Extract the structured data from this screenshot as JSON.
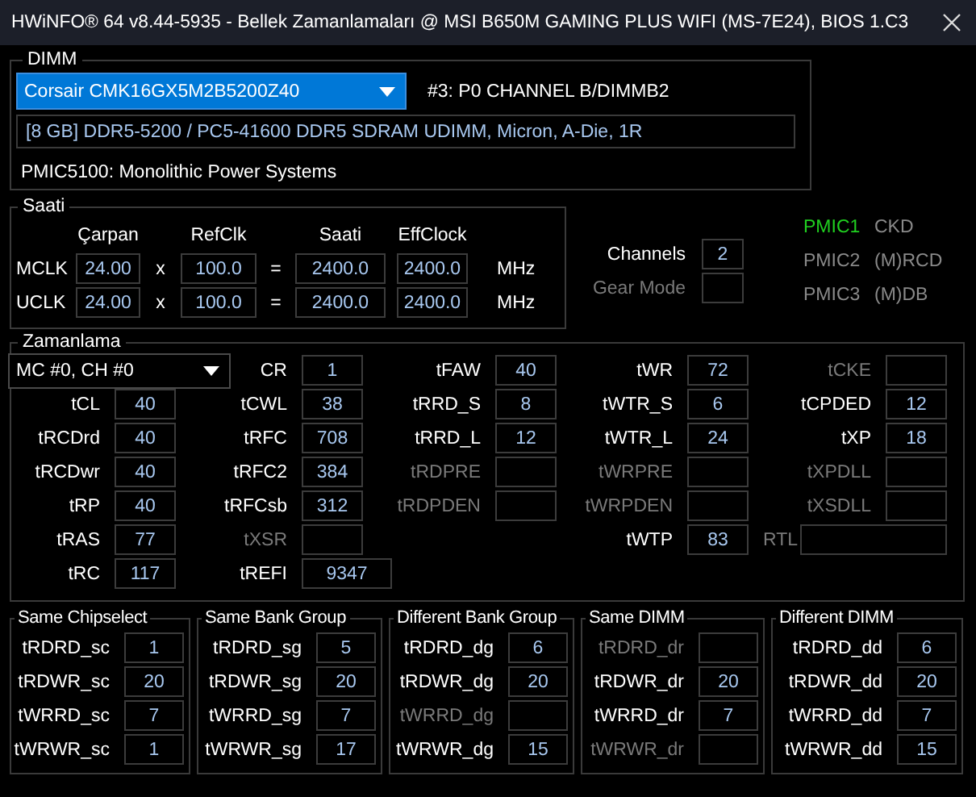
{
  "window": {
    "title": "HWiNFO® 64 v8.44-5935 - Bellek Zamanlamaları @ MSI B650M GAMING PLUS WIFI (MS-7E24), BIOS 1.C3"
  },
  "dimm": {
    "legend": "DIMM",
    "module": "Corsair CMK16GX5M2B5200Z40",
    "slot": "#3: P0 CHANNEL B/DIMMB2",
    "info": "[8 GB] DDR5-5200 / PC5-41600 DDR5 SDRAM UDIMM, Micron, A-Die, 1R",
    "pmic": "PMIC5100: Monolithic Power Systems"
  },
  "clock": {
    "legend": "Saati",
    "headers": [
      "Çarpan",
      "RefClk",
      "Saati",
      "EffClock"
    ],
    "rows": [
      {
        "label": "MCLK",
        "multiplier": "24.00",
        "times": "x",
        "refclk": "100.0",
        "equals": "=",
        "clock": "2400.0",
        "effclock": "2400.0",
        "unit": "MHz"
      },
      {
        "label": "UCLK",
        "multiplier": "24.00",
        "times": "x",
        "refclk": "100.0",
        "equals": "=",
        "clock": "2400.0",
        "effclock": "2400.0",
        "unit": "MHz"
      }
    ]
  },
  "memory_info": [
    {
      "label": "Channels",
      "value": "2",
      "disabled": false
    },
    {
      "label": "Gear Mode",
      "disabled": true
    }
  ],
  "pmics": [
    {
      "label": "PMIC1",
      "name": "CKD",
      "active": true
    },
    {
      "label": "PMIC2",
      "name": "(M)RCD",
      "active": false
    },
    {
      "label": "PMIC3",
      "name": "(M)DB",
      "active": false
    }
  ],
  "timings": {
    "legend": "Zamanlama",
    "controller": "MC #0, CH #0",
    "columns": [
      [
        {
          "kind": "field",
          "label": "tCL",
          "value": "40",
          "disabled": false
        },
        {
          "kind": "field",
          "label": "tRCDrd",
          "value": "40",
          "disabled": false
        },
        {
          "kind": "field",
          "label": "tRCDwr",
          "value": "40",
          "disabled": false
        },
        {
          "kind": "field",
          "label": "tRP",
          "value": "40",
          "disabled": false
        },
        {
          "kind": "field",
          "label": "tRAS",
          "value": "77",
          "disabled": false
        },
        {
          "kind": "field",
          "label": "tRC",
          "value": "117",
          "disabled": false
        }
      ],
      [
        {
          "kind": "field",
          "label": "CR",
          "value": "1",
          "disabled": false
        },
        {
          "kind": "field",
          "label": "tCWL",
          "value": "38",
          "disabled": false
        },
        {
          "kind": "field",
          "label": "tRFC",
          "value": "708",
          "disabled": false
        },
        {
          "kind": "field",
          "label": "tRFC2",
          "value": "384",
          "disabled": false
        },
        {
          "kind": "field",
          "label": "tRFCsb",
          "value": "312",
          "disabled": false
        },
        {
          "kind": "field",
          "label": "tXSR",
          "disabled": true
        },
        {
          "kind": "wide",
          "label": "tREFI",
          "value": "9347",
          "disabled": false
        }
      ],
      [
        {
          "kind": "field",
          "label": "tFAW",
          "value": "40",
          "disabled": false
        },
        {
          "kind": "field",
          "label": "tRRD_S",
          "value": "8",
          "disabled": false
        },
        {
          "kind": "field",
          "label": "tRRD_L",
          "value": "12",
          "disabled": false
        },
        {
          "kind": "field",
          "label": "tRDPRE",
          "disabled": true
        },
        {
          "kind": "field",
          "label": "tRDPDEN",
          "disabled": true
        }
      ],
      [
        {
          "kind": "field",
          "label": "tWR",
          "value": "72",
          "disabled": false
        },
        {
          "kind": "field",
          "label": "tWTR_S",
          "value": "6",
          "disabled": false
        },
        {
          "kind": "field",
          "label": "tWTR_L",
          "value": "24",
          "disabled": false
        },
        {
          "kind": "field",
          "label": "tWRPRE",
          "disabled": true
        },
        {
          "kind": "field",
          "label": "tWRPDEN",
          "disabled": true
        },
        {
          "kind": "field",
          "label": "tWTP",
          "value": "83",
          "disabled": false
        }
      ],
      [
        {
          "kind": "field",
          "label": "tCKE",
          "disabled": true
        },
        {
          "kind": "field",
          "label": "tCPDED",
          "value": "12",
          "disabled": false
        },
        {
          "kind": "field",
          "label": "tXP",
          "value": "18",
          "disabled": false
        },
        {
          "kind": "field",
          "label": "tXPDLL",
          "disabled": true
        },
        {
          "kind": "field",
          "label": "tXSDLL",
          "disabled": true
        },
        {
          "kind": "inline",
          "label": "RTL",
          "disabled": true
        }
      ]
    ]
  },
  "groups": [
    {
      "legend": "Same Chipselect",
      "items": [
        {
          "label": "tRDRD_sc",
          "value": "1",
          "disabled": false
        },
        {
          "label": "tRDWR_sc",
          "value": "20",
          "disabled": false
        },
        {
          "label": "tWRRD_sc",
          "value": "7",
          "disabled": false
        },
        {
          "label": "tWRWR_sc",
          "value": "1",
          "disabled": false
        }
      ]
    },
    {
      "legend": "Same Bank Group",
      "items": [
        {
          "label": "tRDRD_sg",
          "value": "5",
          "disabled": false
        },
        {
          "label": "tRDWR_sg",
          "value": "20",
          "disabled": false
        },
        {
          "label": "tWRRD_sg",
          "value": "7",
          "disabled": false
        },
        {
          "label": "tWRWR_sg",
          "value": "17",
          "disabled": false
        }
      ]
    },
    {
      "legend": "Different Bank Group",
      "items": [
        {
          "label": "tRDRD_dg",
          "value": "6",
          "disabled": false
        },
        {
          "label": "tRDWR_dg",
          "value": "20",
          "disabled": false
        },
        {
          "label": "tWRRD_dg",
          "disabled": true
        },
        {
          "label": "tWRWR_dg",
          "value": "15",
          "disabled": false
        }
      ]
    },
    {
      "legend": "Same DIMM",
      "items": [
        {
          "label": "tRDRD_dr",
          "disabled": true
        },
        {
          "label": "tRDWR_dr",
          "value": "20",
          "disabled": false
        },
        {
          "label": "tWRRD_dr",
          "value": "7",
          "disabled": false
        },
        {
          "label": "tWRWR_dr",
          "disabled": true
        }
      ]
    },
    {
      "legend": "Different DIMM",
      "items": [
        {
          "label": "tRDRD_dd",
          "value": "6",
          "disabled": false
        },
        {
          "label": "tRDWR_dd",
          "value": "20",
          "disabled": false
        },
        {
          "label": "tWRRD_dd",
          "value": "7",
          "disabled": false
        },
        {
          "label": "tWRWR_dd",
          "value": "15",
          "disabled": false
        }
      ]
    }
  ]
}
